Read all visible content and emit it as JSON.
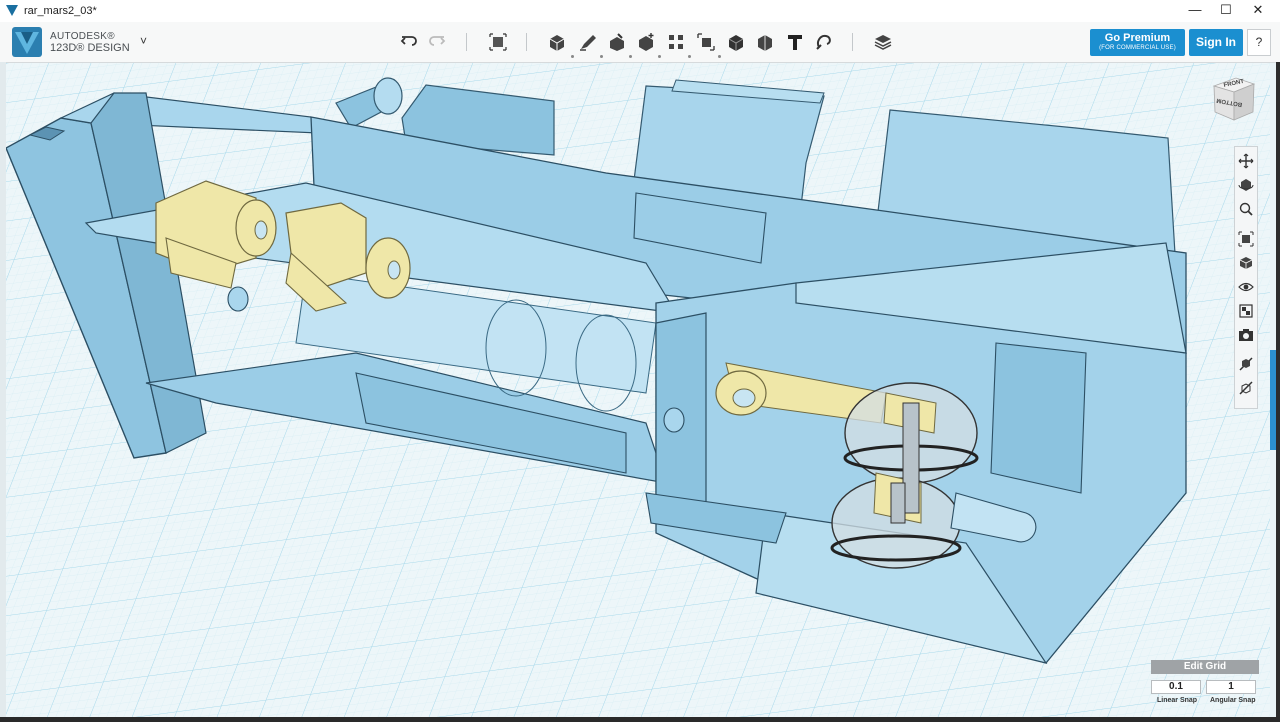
{
  "window": {
    "title": "rar_mars2_03*",
    "minimize_icon": "minimize-icon",
    "maximize_icon": "maximize-icon",
    "close_icon": "close-icon",
    "minimize_glyph": "—",
    "maximize_glyph": "☐",
    "close_glyph": "✕"
  },
  "brand": {
    "line1": "AUTODESK®",
    "line2": "123D® DESIGN",
    "menu_glyph": "˅"
  },
  "toolbar": {
    "tools": [
      "undo-icon",
      "redo-icon",
      "transform-icon",
      "primitives-icon",
      "sketch-icon",
      "construct-icon",
      "modify-icon",
      "pattern-icon",
      "group-icon",
      "combine-icon",
      "measure-icon",
      "text-icon",
      "snap-icon",
      "material-icon"
    ]
  },
  "account": {
    "premium_label": "Go Premium",
    "premium_sub": "(FOR COMMERCIAL USE)",
    "signin_label": "Sign In",
    "help_label": "?"
  },
  "viewcube": {
    "top_label": "FRONT",
    "side_label": "BOTTOM"
  },
  "nav": {
    "tools": [
      "pan-icon",
      "orbit-icon",
      "zoom-icon",
      "fit-icon",
      "view-icon",
      "visibility-icon",
      "materials-icon",
      "camera-icon",
      "outline-icon",
      "grid-icon"
    ]
  },
  "grid": {
    "edit_label": "Edit Grid",
    "linear_value": "0.1",
    "angular_value": "1",
    "linear_label": "Linear Snap",
    "angular_label": "Angular Snap"
  },
  "colors": {
    "accent": "#1b8fd0",
    "part_blue": "#9fcde8",
    "part_yellow": "#efe7a8",
    "grid_line": "#9ed3e6"
  }
}
